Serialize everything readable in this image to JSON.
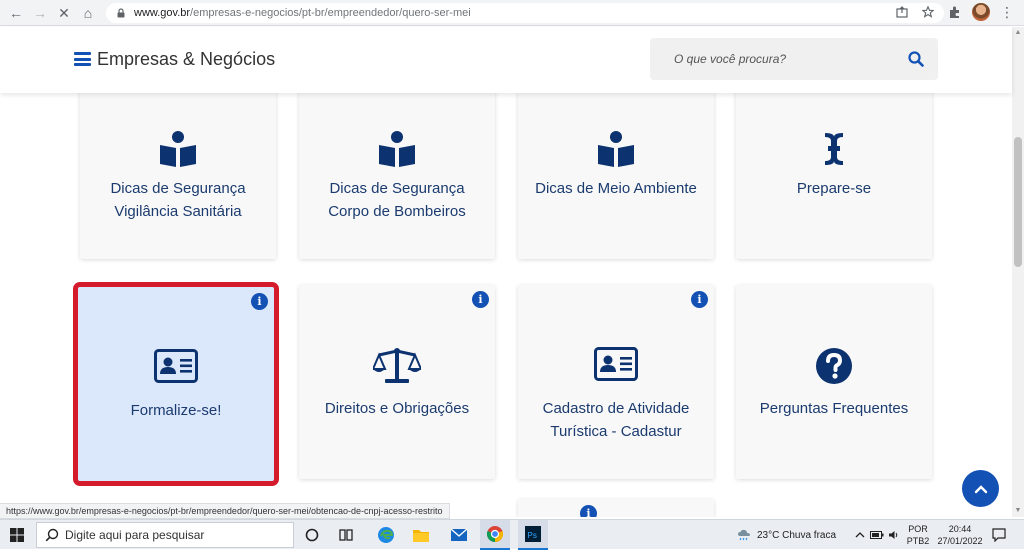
{
  "browser": {
    "url_host": "www.gov.br",
    "url_path": "/empresas-e-negocios/pt-br/empreendedor/quero-ser-mei"
  },
  "header": {
    "site_title": "Empresas & Negócios",
    "search_placeholder": "O que você procura?"
  },
  "cards_row1": [
    {
      "label_line1": "Dicas de Segurança",
      "label_line2": "Vigilância Sanitária",
      "icon": "book-reader-icon"
    },
    {
      "label_line1": "Dicas de Segurança",
      "label_line2": "Corpo de Bombeiros",
      "icon": "book-reader-icon"
    },
    {
      "label_line1": "Dicas de Meio Ambiente",
      "label_line2": "",
      "icon": "book-reader-icon"
    },
    {
      "label_line1": "Prepare-se",
      "label_line2": "",
      "icon": "text-cursor-icon"
    }
  ],
  "cards_row2": [
    {
      "label_line1": "Formalize-se!",
      "label_line2": "",
      "icon": "id-card-icon",
      "selected": true
    },
    {
      "label_line1": "Direitos e Obrigações",
      "label_line2": "",
      "icon": "balance-scale-icon"
    },
    {
      "label_line1": "Cadastro de Atividade",
      "label_line2": "Turística - Cadastur",
      "icon": "id-card-icon"
    },
    {
      "label_line1": "Perguntas Frequentes",
      "label_line2": "",
      "icon": "question-circle-icon"
    }
  ],
  "info_glyph": "i",
  "status_url": "https://www.gov.br/empresas-e-negocios/pt-br/empreendedor/quero-ser-mei/obtencao-de-cnpj-acesso-restrito",
  "taskbar": {
    "search_placeholder": "Digite aqui para pesquisar",
    "weather": "23°C  Chuva fraca",
    "lang_line1": "POR",
    "lang_line2": "PTB2",
    "time": "20:44",
    "date": "27/01/2022"
  },
  "colors": {
    "brand_blue": "#1351b4",
    "card_text": "#1b3b6f",
    "icon_navy": "#0c326f",
    "selected_outline": "#d31b2c",
    "selected_bg": "#dbe8fb"
  }
}
